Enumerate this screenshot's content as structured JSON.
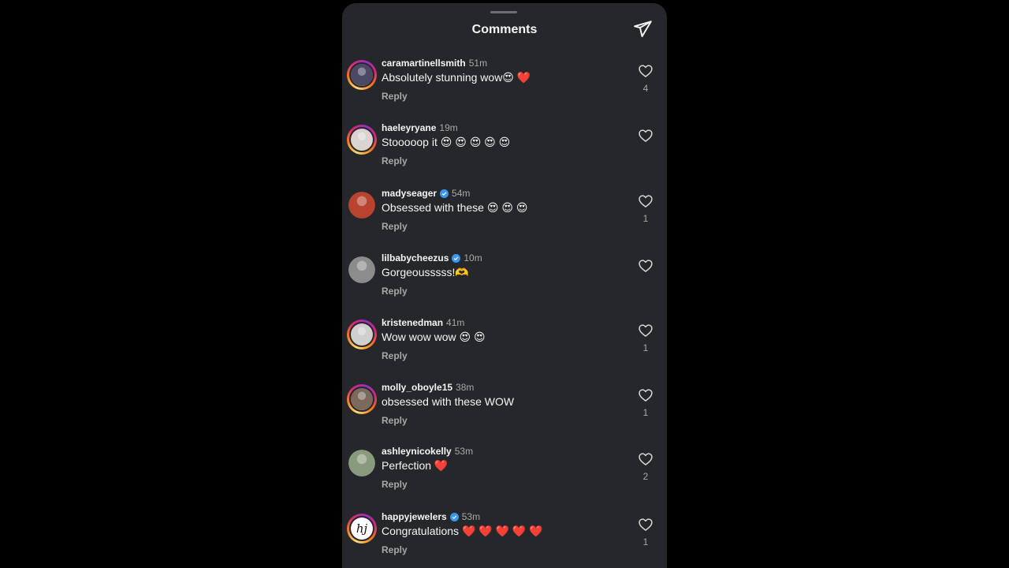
{
  "header": {
    "title": "Comments",
    "share_icon": "paper-plane-icon"
  },
  "colors": {
    "background": "#000000",
    "sheet": "#25272b",
    "text_primary": "#f5f5f5",
    "text_secondary": "#a8a8a8",
    "verified": "#3897f0"
  },
  "comments": [
    {
      "username": "caramartinellsmith",
      "verified": false,
      "time": "51m",
      "text": "Absolutely stunning wow😍 ❤️",
      "reply_label": "Reply",
      "likes": "4",
      "ring": true,
      "avatar_color": "#4a4a66"
    },
    {
      "username": "haeleyryane",
      "verified": false,
      "time": "19m",
      "text": "Stooooop it 😍 😍 😍 😍 😍",
      "reply_label": "Reply",
      "likes": "",
      "ring": true,
      "avatar_color": "#d9d4cf"
    },
    {
      "username": "madyseager",
      "verified": true,
      "time": "54m",
      "text": "Obsessed with these 😍 😍 😍",
      "reply_label": "Reply",
      "likes": "1",
      "ring": false,
      "avatar_color": "#b8432f"
    },
    {
      "username": "lilbabycheezus",
      "verified": true,
      "time": "10m",
      "text": "Gorgeousssss!🫶",
      "reply_label": "Reply",
      "likes": "",
      "ring": false,
      "avatar_color": "#8c8c8c"
    },
    {
      "username": "kristenedman",
      "verified": false,
      "time": "41m",
      "text": "Wow wow wow 😍 😍",
      "reply_label": "Reply",
      "likes": "1",
      "ring": true,
      "avatar_color": "#cfcfcf"
    },
    {
      "username": "molly_oboyle15",
      "verified": false,
      "time": "38m",
      "text": "obsessed with these WOW",
      "reply_label": "Reply",
      "likes": "1",
      "ring": true,
      "avatar_color": "#7a6a5e"
    },
    {
      "username": "ashleynicokelly",
      "verified": false,
      "time": "53m",
      "text": "Perfection ❤️",
      "reply_label": "Reply",
      "likes": "2",
      "ring": false,
      "avatar_color": "#8a9a7e"
    },
    {
      "username": "happyjewelers",
      "verified": true,
      "time": "53m",
      "text": "Congratulations ❤️ ❤️ ❤️ ❤️ ❤️",
      "reply_label": "Reply",
      "likes": "1",
      "ring": true,
      "avatar_color": "#ffffff",
      "avatar_text": "hj"
    }
  ]
}
